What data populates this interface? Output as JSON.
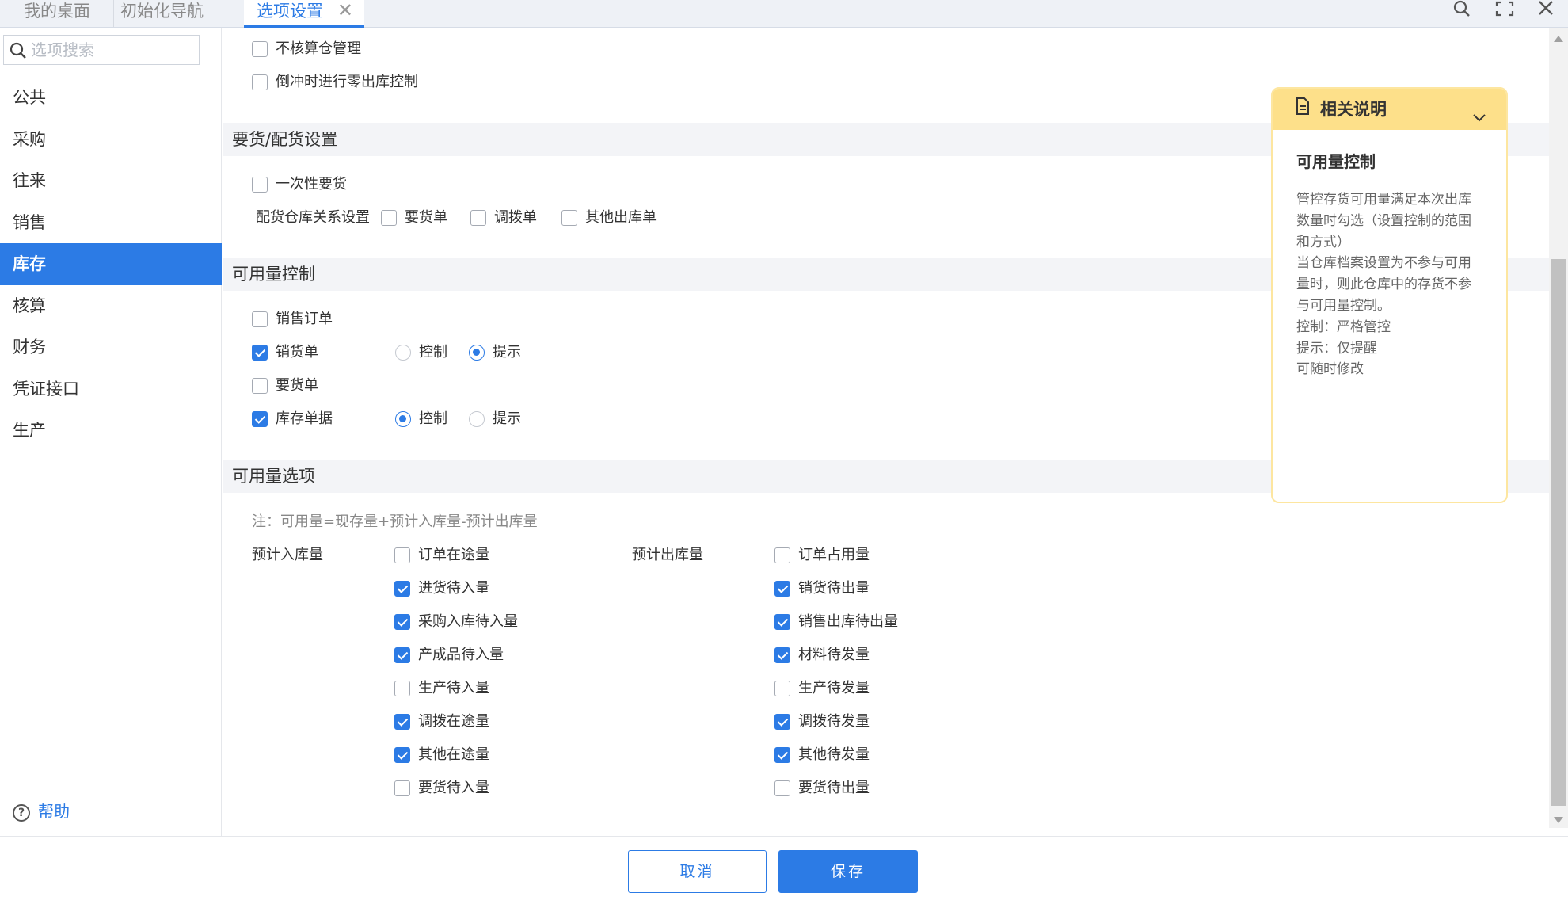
{
  "tabs": [
    {
      "label": "我的桌面"
    },
    {
      "label": "初始化导航"
    },
    {
      "label": "选项设置",
      "close": "✕"
    }
  ],
  "sidebar": {
    "search_placeholder": "选项搜索",
    "items": [
      {
        "label": "公共"
      },
      {
        "label": "采购"
      },
      {
        "label": "往来"
      },
      {
        "label": "销售"
      },
      {
        "label": "库存",
        "active": true
      },
      {
        "label": "核算"
      },
      {
        "label": "财务"
      },
      {
        "label": "凭证接口"
      },
      {
        "label": "生产"
      }
    ],
    "help_label": "帮助"
  },
  "top_options": [
    {
      "label": "不核算仓管理",
      "checked": false
    },
    {
      "label": "倒冲时进行零出库控制",
      "checked": false
    }
  ],
  "section_requisition": {
    "title": "要货/配货设置",
    "one_time": {
      "label": "一次性要货",
      "checked": false
    },
    "relation_label": "配货仓库关系设置",
    "relation_options": [
      {
        "label": "要货单",
        "checked": false
      },
      {
        "label": "调拨单",
        "checked": false
      },
      {
        "label": "其他出库单",
        "checked": false
      }
    ]
  },
  "section_available_control": {
    "title": "可用量控制",
    "rows": [
      {
        "label": "销售订单",
        "checked": false
      },
      {
        "label": "销货单",
        "checked": true,
        "control": "控制",
        "hint": "提示",
        "selected": "提示"
      },
      {
        "label": "要货单",
        "checked": false
      },
      {
        "label": "库存单据",
        "checked": true,
        "control": "控制",
        "hint": "提示",
        "selected": "控制"
      }
    ]
  },
  "section_available_options": {
    "title": "可用量选项",
    "note": "注：可用量=现存量+预计入库量-预计出库量",
    "inbound_label": "预计入库量",
    "outbound_label": "预计出库量",
    "inbound": [
      {
        "label": "订单在途量",
        "checked": false
      },
      {
        "label": "进货待入量",
        "checked": true
      },
      {
        "label": "采购入库待入量",
        "checked": true
      },
      {
        "label": "产成品待入量",
        "checked": true
      },
      {
        "label": "生产待入量",
        "checked": false
      },
      {
        "label": "调拨在途量",
        "checked": true
      },
      {
        "label": "其他在途量",
        "checked": true
      },
      {
        "label": "要货待入量",
        "checked": false
      }
    ],
    "outbound": [
      {
        "label": "订单占用量",
        "checked": false
      },
      {
        "label": "销货待出量",
        "checked": true
      },
      {
        "label": "销售出库待出量",
        "checked": true
      },
      {
        "label": "材料待发量",
        "checked": true
      },
      {
        "label": "生产待发量",
        "checked": false
      },
      {
        "label": "调拨待发量",
        "checked": true
      },
      {
        "label": "其他待发量",
        "checked": true
      },
      {
        "label": "要货待出量",
        "checked": false
      }
    ]
  },
  "info_panel": {
    "header": "相关说明",
    "title": "可用量控制",
    "lines": [
      "管控存货可用量满足本次出库",
      "数量时勾选（设置控制的范围",
      "和方式）",
      "当仓库档案设置为不参与可用",
      "量时，则此仓库中的存货不参",
      "与可用量控制。",
      "控制：严格管控",
      "提示：仅提醒",
      "可随时修改"
    ]
  },
  "footer": {
    "cancel_label": "取消",
    "save_label": "保存"
  },
  "colors": {
    "accent": "#2c7be5",
    "info_header": "#fde08a",
    "section_bg": "#f3f4f7"
  },
  "icons": [
    "search-icon",
    "fullscreen-icon",
    "close-icon",
    "document-icon",
    "chevron-down-icon",
    "help-icon"
  ]
}
